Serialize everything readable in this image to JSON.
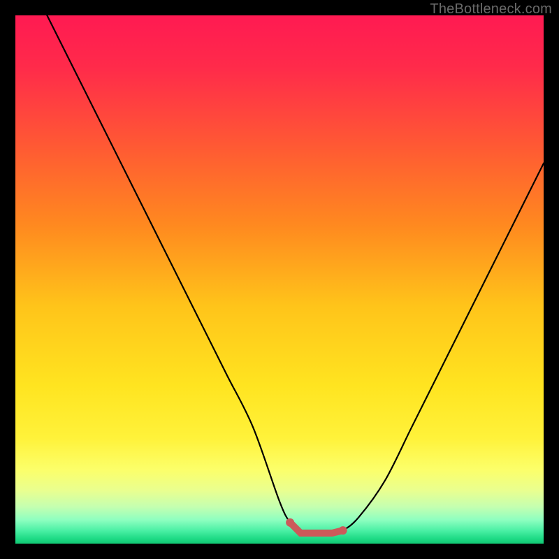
{
  "attribution": "TheBottleneck.com",
  "colors": {
    "frame": "#000000",
    "curve": "#000000",
    "marker": "#cc5a5a",
    "gradient_stops": [
      {
        "offset": 0.0,
        "color": "#ff1a52"
      },
      {
        "offset": 0.1,
        "color": "#ff2b4a"
      },
      {
        "offset": 0.25,
        "color": "#ff5a33"
      },
      {
        "offset": 0.4,
        "color": "#ff8a1f"
      },
      {
        "offset": 0.55,
        "color": "#ffc41a"
      },
      {
        "offset": 0.7,
        "color": "#ffe420"
      },
      {
        "offset": 0.8,
        "color": "#fff23a"
      },
      {
        "offset": 0.86,
        "color": "#fcff6a"
      },
      {
        "offset": 0.9,
        "color": "#e9ff90"
      },
      {
        "offset": 0.93,
        "color": "#c5ffb0"
      },
      {
        "offset": 0.955,
        "color": "#8effc0"
      },
      {
        "offset": 0.975,
        "color": "#4cf0a5"
      },
      {
        "offset": 0.99,
        "color": "#1fdb86"
      },
      {
        "offset": 1.0,
        "color": "#12c874"
      }
    ]
  },
  "chart_data": {
    "type": "line",
    "title": "",
    "xlabel": "",
    "ylabel": "",
    "xlim": [
      0,
      100
    ],
    "ylim": [
      0,
      100
    ],
    "grid": false,
    "series": [
      {
        "name": "curve",
        "x": [
          6,
          10,
          15,
          20,
          25,
          30,
          35,
          40,
          45,
          50,
          52,
          54,
          56,
          58,
          60,
          62,
          65,
          70,
          75,
          80,
          85,
          90,
          95,
          100
        ],
        "y": [
          100,
          92,
          82,
          72,
          62,
          52,
          42,
          32,
          22,
          8,
          4,
          2,
          2,
          2,
          2,
          2.5,
          5,
          12,
          22,
          32,
          42,
          52,
          62,
          72
        ]
      }
    ],
    "marker_region": {
      "x_start": 52,
      "x_end": 62,
      "y": 2
    }
  }
}
